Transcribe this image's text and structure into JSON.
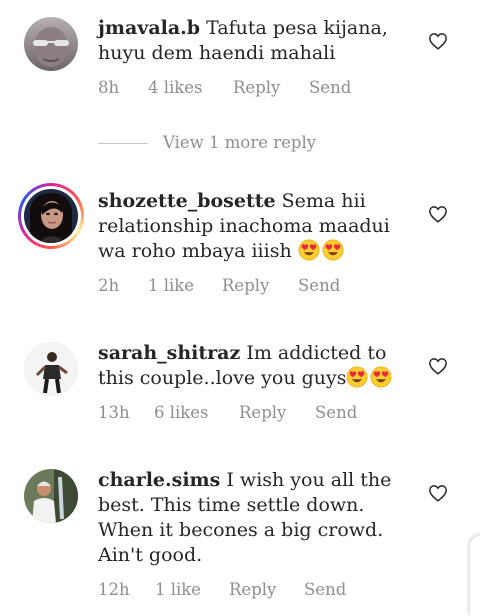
{
  "view_more_replies": "View 1 more reply",
  "comments": [
    {
      "username": "jmavala.b",
      "text": "Tafuta pesa kijana, huyu dem haendi mahali",
      "time": "8h",
      "likes": "4 likes",
      "reply": "Reply",
      "send": "Send",
      "story_ring": false
    },
    {
      "username": "shozette_bosette",
      "text": "Sema hii relationship inachoma maadui wa roho mbaya iiish",
      "emojis": [
        "heart-eyes",
        "heart-eyes"
      ],
      "time": "2h",
      "likes": "1 like",
      "reply": "Reply",
      "send": "Send",
      "story_ring": true
    },
    {
      "username": "sarah_shitraz",
      "text": "Im addicted to this couple..love you guys",
      "emojis": [
        "heart-eyes",
        "heart-eyes"
      ],
      "time": "13h",
      "likes": "6 likes",
      "reply": "Reply",
      "send": "Send",
      "story_ring": false
    },
    {
      "username": "charle.sims",
      "text": "I wish you all the best. This time settle down. When it becones a big crowd. Ain't good.",
      "time": "12h",
      "likes": "1 like",
      "reply": "Reply",
      "send": "Send",
      "story_ring": false
    }
  ],
  "colors": {
    "text": "#262626",
    "muted": "#8e8e8e",
    "divider": "#c7c7c7"
  }
}
